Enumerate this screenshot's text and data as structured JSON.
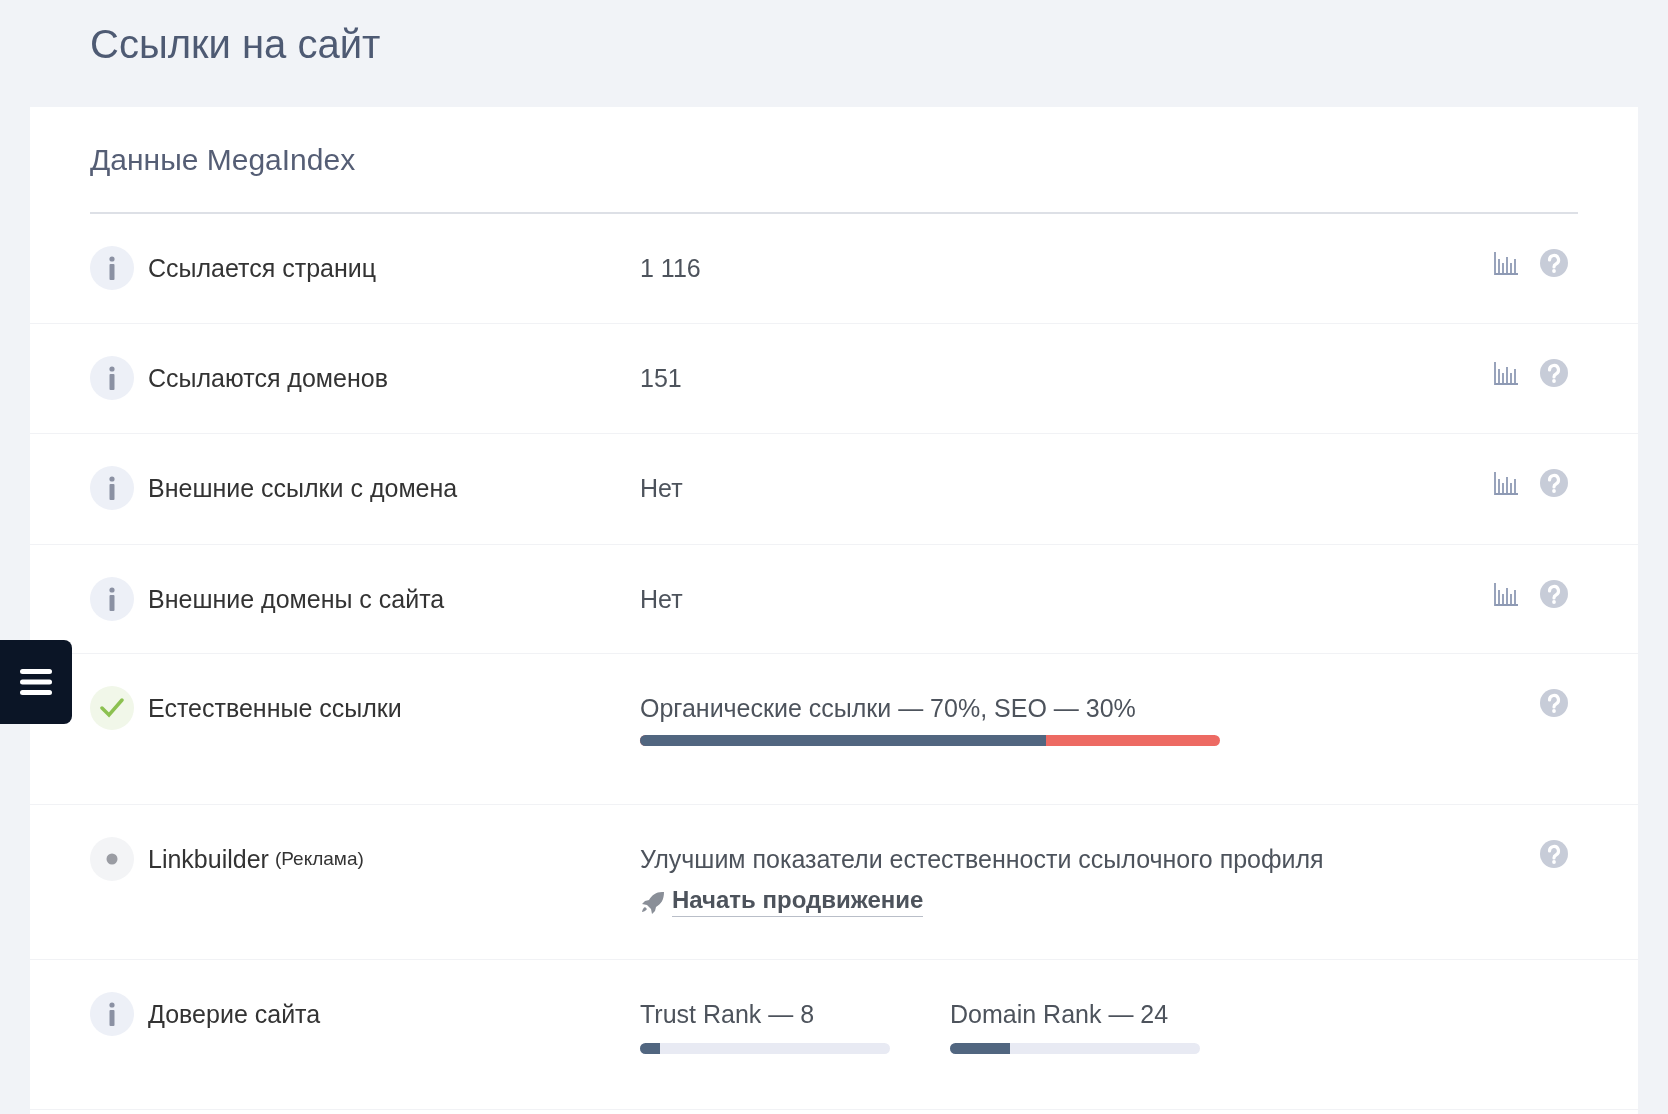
{
  "page_title": "Ссылки на сайт",
  "section": {
    "title": "Данные MegaIndex"
  },
  "rows": [
    {
      "kind": "stat",
      "label": "Ссылается страниц",
      "value": "1 116"
    },
    {
      "kind": "stat",
      "label": "Ссылаются доменов",
      "value": "151"
    },
    {
      "kind": "stat",
      "label": "Внешние ссылки с домена",
      "value": "Нет"
    },
    {
      "kind": "stat",
      "label": "Внешние домены с сайта",
      "value": "Нет"
    },
    {
      "kind": "ratio",
      "label": "Естественные ссылки",
      "value": "Органические ссылки — 70%, SEO — 30%",
      "level": 0.7
    },
    {
      "kind": "promo",
      "label": "Linkbuilder",
      "note": "(Реклама)",
      "value": "Улучшим показатели естественности ссылочного профиля",
      "link": "Начать продвижение"
    },
    {
      "kind": "ranks",
      "label": "Доверие сайта",
      "ranks": [
        {
          "label": "Trust Rank — 8",
          "level": 0.08
        },
        {
          "label": "Domain Rank — 24",
          "level": 0.24
        }
      ]
    }
  ]
}
